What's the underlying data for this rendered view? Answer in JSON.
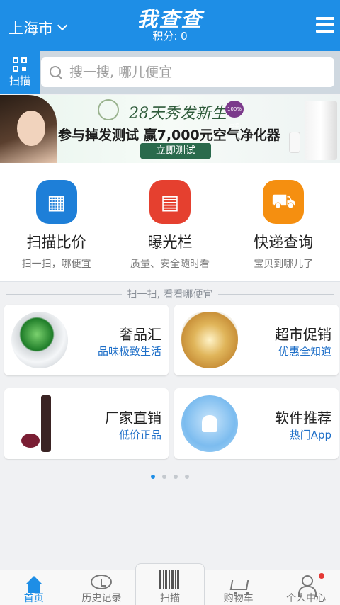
{
  "header": {
    "city": "上海市",
    "logo": "我查查",
    "points": "积分: 0"
  },
  "search": {
    "scan_label": "扫描",
    "placeholder": "搜一搜, 哪儿便宜"
  },
  "banner": {
    "headline": "28天秀发新生",
    "badge": "100%中奖",
    "text": "参与掉发测试 赢7,000元空气净化器",
    "button": "立即测试"
  },
  "features": [
    {
      "title": "扫描比价",
      "subtitle": "扫一扫，哪便宜",
      "icon": "barcode-scan-icon",
      "color": "#1e7fd8"
    },
    {
      "title": "曝光栏",
      "subtitle": "质量、安全随时看",
      "icon": "news-icon",
      "color": "#e5402f"
    },
    {
      "title": "快递查询",
      "subtitle": "宝贝到哪儿了",
      "icon": "delivery-truck-icon",
      "color": "#f58f10"
    }
  ],
  "divider_text": "扫一扫, 看看哪便宜",
  "cards": [
    {
      "title": "奢品汇",
      "subtitle": "品味极致生活"
    },
    {
      "title": "超市促销",
      "subtitle": "优惠全知道"
    },
    {
      "title": "厂家直销",
      "subtitle": "低价正品"
    },
    {
      "title": "软件推荐",
      "subtitle": "热门App"
    }
  ],
  "pagination": {
    "total": 4,
    "active": 1
  },
  "tabs": [
    {
      "label": "首页",
      "icon": "home-icon",
      "active": true
    },
    {
      "label": "历史记录",
      "icon": "clock-icon"
    },
    {
      "label": "扫描",
      "icon": "barcode-icon"
    },
    {
      "label": "购物车",
      "icon": "cart-icon"
    },
    {
      "label": "个人中心",
      "icon": "user-icon"
    }
  ],
  "colors": {
    "primary": "#1e8ee6",
    "link": "#1e6fc8"
  }
}
